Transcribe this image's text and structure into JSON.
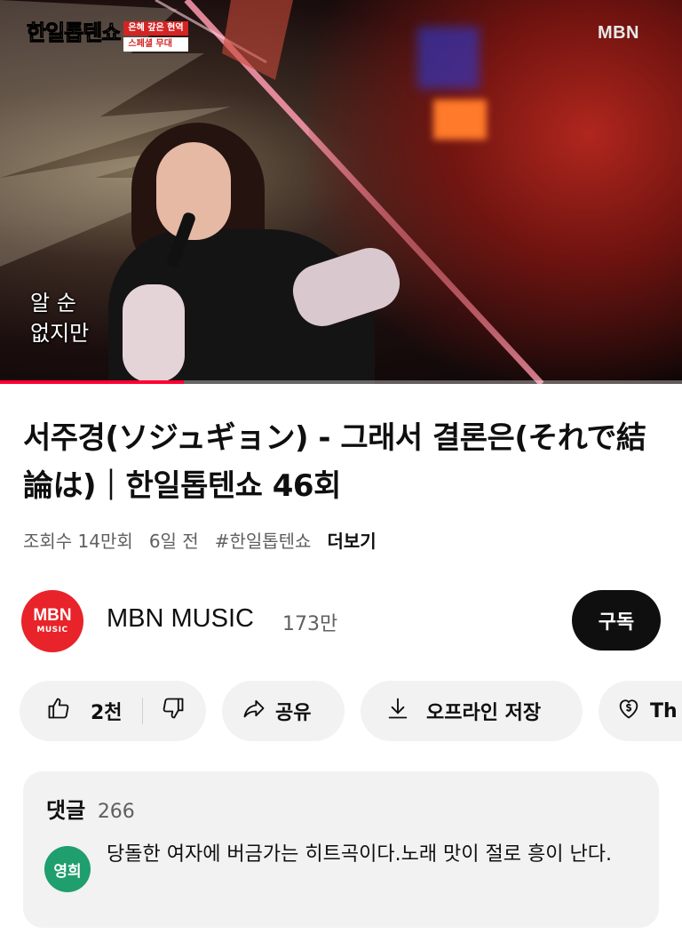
{
  "player": {
    "show_logo": "한일톱텐쇼",
    "show_tags": [
      "은혜 갚은 현역",
      "스페셜 무대"
    ],
    "watermark": "MBN",
    "caption_lines": [
      "알 순",
      "없지만"
    ],
    "progress_fraction": 0.27,
    "progress_color": "#ff0033"
  },
  "video": {
    "title": "서주경(ソジュギョン) - 그래서 결론은(それで結論は)｜한일톱텐쇼 46회",
    "views": "조회수 14만회",
    "age": "6일 전",
    "hashtag": "#한일톱텐쇼",
    "more_label": "더보기"
  },
  "channel": {
    "avatar_line1": "MBN",
    "avatar_line2": "MUSIC",
    "avatar_color": "#e8232a",
    "name": "MBN MUSIC",
    "subscribers": "173만",
    "subscribe_label": "구독"
  },
  "actions": {
    "like_count": "2천",
    "share_label": "공유",
    "save_label": "오프라인 저장",
    "thanks_label": "Th",
    "icons": [
      "thumbs-up-icon",
      "thumbs-down-icon",
      "share-arrow-icon",
      "download-icon",
      "heart-dollar-icon"
    ]
  },
  "comments": {
    "label": "댓글",
    "count": "266",
    "top_comment": {
      "author_initials": "영희",
      "avatar_color": "#1f9e6e",
      "text": "당돌한 여자에 버금가는 히트곡이다.노래  맛이 절로 흥이 난다."
    }
  }
}
